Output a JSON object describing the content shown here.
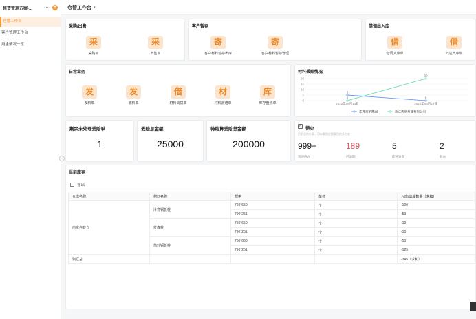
{
  "sidebar": {
    "title": "租赁管理方案-...",
    "more": "⋯",
    "add": "+",
    "items": [
      {
        "label": "仓管工作台"
      },
      {
        "label": "客户管理工作台"
      },
      {
        "label": "用金情况一览"
      }
    ]
  },
  "topbar": {
    "title": "仓管工作台",
    "chevron": "▾"
  },
  "purchase": {
    "title": "采购/出售",
    "items": [
      {
        "icon": "采",
        "label": "采购单"
      },
      {
        "icon": "采",
        "label": "出售单"
      }
    ]
  },
  "storage": {
    "title": "客户暂存",
    "items": [
      {
        "icon": "寄",
        "label": "客户材料暂存出库"
      },
      {
        "icon": "寄",
        "label": "客户材料暂存管理"
      }
    ]
  },
  "borrow": {
    "title": "借调出入库",
    "items": [
      {
        "icon": "借",
        "label": "借调入库单"
      },
      {
        "icon": "借",
        "label": "归还出库单"
      }
    ]
  },
  "daily": {
    "title": "日常业务",
    "items": [
      {
        "icon": "发",
        "label": "发料单"
      },
      {
        "icon": "发",
        "label": "收料单"
      },
      {
        "icon": "借",
        "label": "材料调拨单"
      },
      {
        "icon": "材",
        "label": "材料丢赔单"
      },
      {
        "icon": "库",
        "label": "库存盘点单"
      }
    ]
  },
  "loss_chart": {
    "title": "材料丢赔情况",
    "chart_data": {
      "type": "line",
      "x": [
        "2022年08月14日",
        "2022年08月20日"
      ],
      "y_ticks": [
        "0",
        "5",
        "10",
        "15",
        "20"
      ],
      "ylim": [
        0,
        20
      ],
      "series": [
        {
          "name": "江苏天宇集团",
          "values": [
            5,
            0
          ],
          "color": "#5b8ff9",
          "labels": [
            "5",
            "0"
          ]
        },
        {
          "name": "浙江天幕幕墙有限公司",
          "values": [
            0,
            20
          ],
          "color": "#5ad8a6",
          "labels": [
            "0",
            "20"
          ]
        }
      ]
    }
  },
  "stats": [
    {
      "title": "剩余未处理丢赔单",
      "value": "1"
    },
    {
      "title": "丢赔总金额",
      "value": "25000"
    },
    {
      "title": "待结算丢赔总金额",
      "value": "200000"
    }
  ],
  "todo": {
    "title": "待办",
    "subtitle": "目前总待办事，可以看到近期事目前多方查",
    "items": [
      {
        "value": "999+",
        "label": "我的待办",
        "color": "#222"
      },
      {
        "value": "189",
        "label": "已逾期",
        "color": "#e0525a"
      },
      {
        "value": "5",
        "label": "即将逾期",
        "color": "#222"
      },
      {
        "value": "2",
        "label": "催办",
        "color": "#222"
      }
    ]
  },
  "inventory": {
    "title": "当前库存",
    "export": "导出",
    "headers": [
      "仓库名称",
      "材料名称",
      "规格",
      "单位",
      "入库/出库数量（求和）"
    ],
    "warehouse": "南京自有仓",
    "materials": [
      "冷弯钢板桩",
      "拉森桩",
      "热轧钢板桩"
    ],
    "rows": [
      {
        "spec": "760*650",
        "unit": "个",
        "qty": "-100"
      },
      {
        "spec": "790*251",
        "unit": "个",
        "qty": "-50"
      },
      {
        "spec": "760*650",
        "unit": "个",
        "qty": "-10"
      },
      {
        "spec": "790*251",
        "unit": "个",
        "qty": "-10"
      },
      {
        "spec": "760*650",
        "unit": "个",
        "qty": "-50"
      },
      {
        "spec": "790*251",
        "unit": "个",
        "qty": "-125"
      }
    ],
    "total_label": "列汇总",
    "total_value": "-345（求和）"
  }
}
